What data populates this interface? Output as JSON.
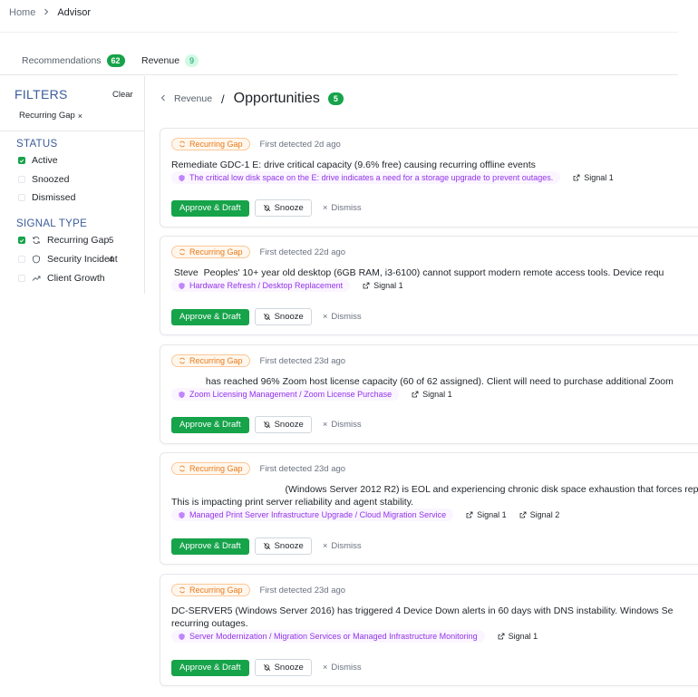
{
  "breadcrumb": {
    "home": "Home",
    "current": "Advisor"
  },
  "tabs": [
    {
      "label": "Recommendations",
      "count": "62"
    },
    {
      "label": "Revenue",
      "count": "9"
    }
  ],
  "filters": {
    "title": "FILTERS",
    "clear": "Clear",
    "active_chip": "Recurring Gap",
    "chip_remove": "×",
    "status_title": "STATUS",
    "status_options": [
      {
        "label": "Active",
        "checked": true
      },
      {
        "label": "Snoozed",
        "checked": false
      },
      {
        "label": "Dismissed",
        "checked": false
      }
    ],
    "signal_title": "SIGNAL TYPE",
    "signal_options": [
      {
        "label": "Recurring Gap",
        "count": "5",
        "checked": true,
        "icon": "refresh-icon"
      },
      {
        "label": "Security Incident",
        "count": "4",
        "checked": false,
        "icon": "shield-icon"
      },
      {
        "label": "Client Growth",
        "count": "",
        "checked": false,
        "icon": "trend-up-icon"
      }
    ]
  },
  "main": {
    "back": "Revenue",
    "slash": "/",
    "title": "Opportunities",
    "count": "5"
  },
  "cards": [
    {
      "tag": "Recurring Gap",
      "detected": "First detected 2d ago",
      "line1": "Remediate GDC-1 E: drive critical capacity (9.6% free) causing recurring offline events",
      "line2": "",
      "service": "The critical low disk space on the E: drive indicates a need for a storage upgrade to prevent outages.",
      "signals": [
        "Signal 1"
      ]
    },
    {
      "tag": "Recurring Gap",
      "detected": "First detected 22d ago",
      "line1": " Steve  Peoples' 10+ year old desktop (6GB RAM, i3-6100) cannot support modern remote access tools. Device requ",
      "line2": "",
      "service": "Hardware Refresh / Desktop Replacement",
      "signals": [
        "Signal 1"
      ]
    },
    {
      "tag": "Recurring Gap",
      "detected": "First detected 23d ago",
      "line1": "             has reached 96% Zoom host license capacity (60 of 62 assigned). Client will need to purchase additional Zoom",
      "line2": "",
      "service": "Zoom Licensing Management / Zoom License Purchase",
      "signals": [
        "Signal 1"
      ]
    },
    {
      "tag": "Recurring Gap",
      "detected": "First detected 23d ago",
      "line1": "                                           (Windows Server 2012 R2) is EOL and experiencing chronic disk space exhaustion that forces repe",
      "line2": "This is impacting print server reliability and agent stability.",
      "service": "Managed Print Server Infrastructure Upgrade / Cloud Migration Service",
      "signals": [
        "Signal 1",
        "Signal 2"
      ]
    },
    {
      "tag": "Recurring Gap",
      "detected": "First detected 23d ago",
      "line1": "DC-SERVER5 (Windows Server 2016) has triggered 4 Device Down alerts in 60 days with DNS instability. Windows Se",
      "line2": "recurring outages.",
      "service": "Server Modernization / Migration Services or Managed Infrastructure Monitoring",
      "signals": [
        "Signal 1"
      ]
    }
  ],
  "actions": {
    "approve": "Approve & Draft",
    "snooze": "Snooze",
    "dismiss": "Dismiss",
    "dismiss_icon": "×"
  }
}
